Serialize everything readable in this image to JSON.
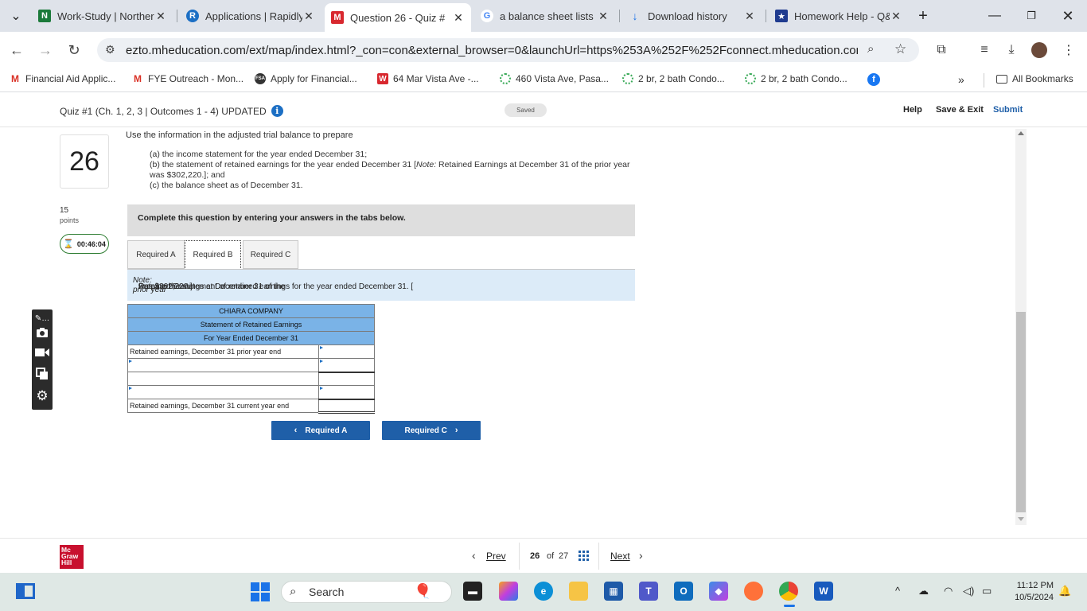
{
  "browser": {
    "tabs": [
      {
        "title": "Work-Study | Norther",
        "icon_letter": "N",
        "icon_color": "#1b7a3a"
      },
      {
        "title": "Applications | Rapidly",
        "icon_letter": "R",
        "icon_color": "#1c6fc4"
      },
      {
        "title": "Question 26 - Quiz #",
        "icon_letter": "M",
        "icon_color": "#d8282f",
        "active": true
      },
      {
        "title": "a balance sheet lists",
        "icon_letter": "G",
        "icon_color": "#4285f4"
      },
      {
        "title": "Download history",
        "icon_letter": "↓",
        "icon_color": "#1a73e8"
      },
      {
        "title": "Homework Help - Q&",
        "icon_letter": "★",
        "icon_color": "#1f3b8f"
      }
    ],
    "new_tab": "+",
    "url": "ezto.mheducation.com/ext/map/index.html?_con=con&external_browser=0&launchUrl=https%253A%252F%252Fconnect.mheducation.com%252F...",
    "bookmarks": [
      {
        "label": "Financial Aid Applic...",
        "icon": "gmail-icon"
      },
      {
        "label": "FYE Outreach - Mon...",
        "icon": "gmail-icon"
      },
      {
        "label": "Apply for Financial...",
        "icon": "fsa-icon"
      },
      {
        "label": "64 Mar Vista Ave -...",
        "icon": "w-icon"
      },
      {
        "label": "460 Vista Ave, Pasa...",
        "icon": "zillow-icon"
      },
      {
        "label": "2 br, 2 bath Condo...",
        "icon": "zillow-icon"
      },
      {
        "label": "2 br, 2 bath Condo...",
        "icon": "zillow-icon"
      }
    ],
    "more_bookmarks": "»",
    "all_bookmarks": "All Bookmarks"
  },
  "quiz": {
    "title": "Quiz #1 (Ch. 1, 2, 3 | Outcomes 1 - 4) UPDATED",
    "saved": "Saved",
    "help": "Help",
    "save_exit": "Save & Exit",
    "submit": "Submit",
    "question_number": "26",
    "points_value": "15",
    "points_label": "points",
    "timer": "00:46:04"
  },
  "question": {
    "intro": "Use the information in the adjusted trial balance to prepare",
    "req_a": "(a) the income statement for the year ended December 31;",
    "req_b_1": "(b) the statement of retained earnings for the year ended December 31 [",
    "req_b_note": "Note:",
    "req_b_2": " Retained Earnings at December 31 of the prior year",
    "req_b_3": "was $302,220.]; and",
    "req_c": "(c) the balance sheet as of December 31.",
    "instruction": "Complete this question by entering your answers in the tabs below.",
    "tabs": [
      "Required A",
      "Required B",
      "Required C"
    ],
    "prompt_1": "Prepare the statement of retained earnings for the year ended December 31. [",
    "prompt_note": "Note:",
    "prompt_2": " Retained Earnings at December 31 of the ",
    "prompt_italic": "prior year",
    "prompt_3": " was $302,220.]"
  },
  "statement": {
    "company": "CHIARA COMPANY",
    "name": "Statement of Retained Earnings",
    "period": "For Year Ended December 31",
    "row_first": "Retained earnings, December 31 prior year end",
    "row_last": "Retained earnings, December 31 current year end"
  },
  "nav": {
    "prev_req": "Required A",
    "next_req": "Required C"
  },
  "footer": {
    "logo": "Mc Graw Hill",
    "prev": "Prev",
    "current": "26",
    "of": "of",
    "total": "27",
    "next": "Next"
  },
  "taskbar": {
    "search": "Search",
    "time": "11:12 PM",
    "date": "10/5/2024"
  }
}
